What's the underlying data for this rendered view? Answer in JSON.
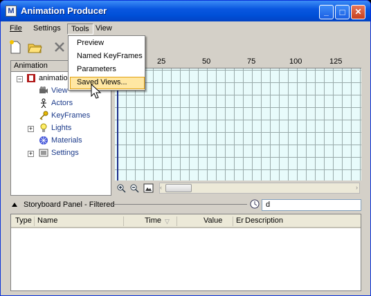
{
  "window": {
    "title": "Animation Producer",
    "minimize": "_",
    "maximize": "□",
    "close": "✕"
  },
  "menu": {
    "file": "File",
    "settings": "Settings",
    "tools": "Tools",
    "view": "View"
  },
  "tools_menu": {
    "items": [
      "Preview",
      "Named KeyFrames",
      "Parameters",
      "Saved Views..."
    ],
    "highlighted_index": 3
  },
  "tree": {
    "header": "Animation",
    "root": "animation",
    "children": [
      "View",
      "Actors",
      "KeyFrames",
      "Lights",
      "Materials",
      "Settings"
    ]
  },
  "ruler": {
    "labels": [
      "25",
      "50",
      "75",
      "100",
      "125"
    ]
  },
  "storyboard": {
    "label": "Storyboard Panel - Filtered",
    "filter_value": "d"
  },
  "table": {
    "columns": [
      "Type",
      "Name",
      "Time",
      "Value",
      "Er",
      "Description"
    ],
    "sort_indicator": "▽"
  },
  "colors": {
    "titlebar": "#0a57e0",
    "grid_bg": "#e8fbfb",
    "menu_highlight": "#ffe7a3"
  }
}
